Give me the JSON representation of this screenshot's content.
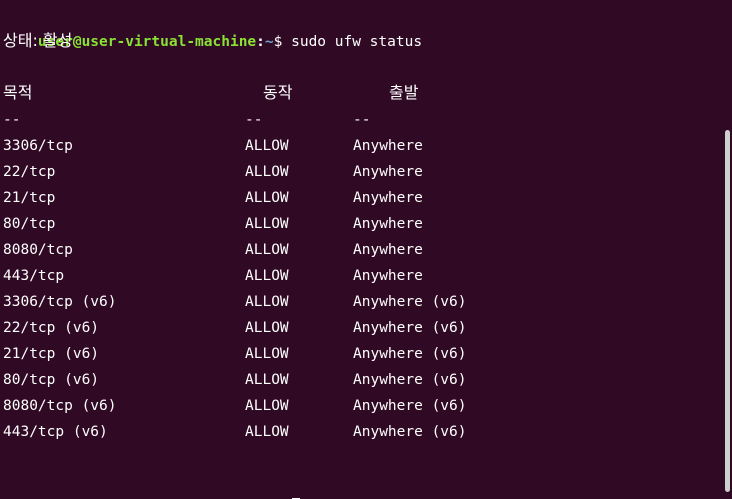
{
  "prompt": {
    "user_host": "user@user-virtual-machine",
    "separator": ":",
    "path": "~",
    "dollar": "$"
  },
  "command": "sudo ufw status",
  "status_line": "상태: 활성",
  "headers": {
    "to": "목적",
    "action": "동작",
    "from": "출발"
  },
  "dashes": {
    "to": "--",
    "action": "--",
    "from": "--"
  },
  "rules": [
    {
      "to": "3306/tcp",
      "action": "ALLOW",
      "from": "Anywhere"
    },
    {
      "to": "22/tcp",
      "action": "ALLOW",
      "from": "Anywhere"
    },
    {
      "to": "21/tcp",
      "action": "ALLOW",
      "from": "Anywhere"
    },
    {
      "to": "80/tcp",
      "action": "ALLOW",
      "from": "Anywhere"
    },
    {
      "to": "8080/tcp",
      "action": "ALLOW",
      "from": "Anywhere"
    },
    {
      "to": "443/tcp",
      "action": "ALLOW",
      "from": "Anywhere"
    },
    {
      "to": "3306/tcp (v6)",
      "action": "ALLOW",
      "from": "Anywhere (v6)"
    },
    {
      "to": "22/tcp (v6)",
      "action": "ALLOW",
      "from": "Anywhere (v6)"
    },
    {
      "to": "21/tcp (v6)",
      "action": "ALLOW",
      "from": "Anywhere (v6)"
    },
    {
      "to": "80/tcp (v6)",
      "action": "ALLOW",
      "from": "Anywhere (v6)"
    },
    {
      "to": "8080/tcp (v6)",
      "action": "ALLOW",
      "from": "Anywhere (v6)"
    },
    {
      "to": "443/tcp (v6)",
      "action": "ALLOW",
      "from": "Anywhere (v6)"
    }
  ],
  "colors": {
    "background": "#300a24",
    "prompt_user": "#8ae234",
    "prompt_path": "#729fcf",
    "text": "#ffffff"
  }
}
